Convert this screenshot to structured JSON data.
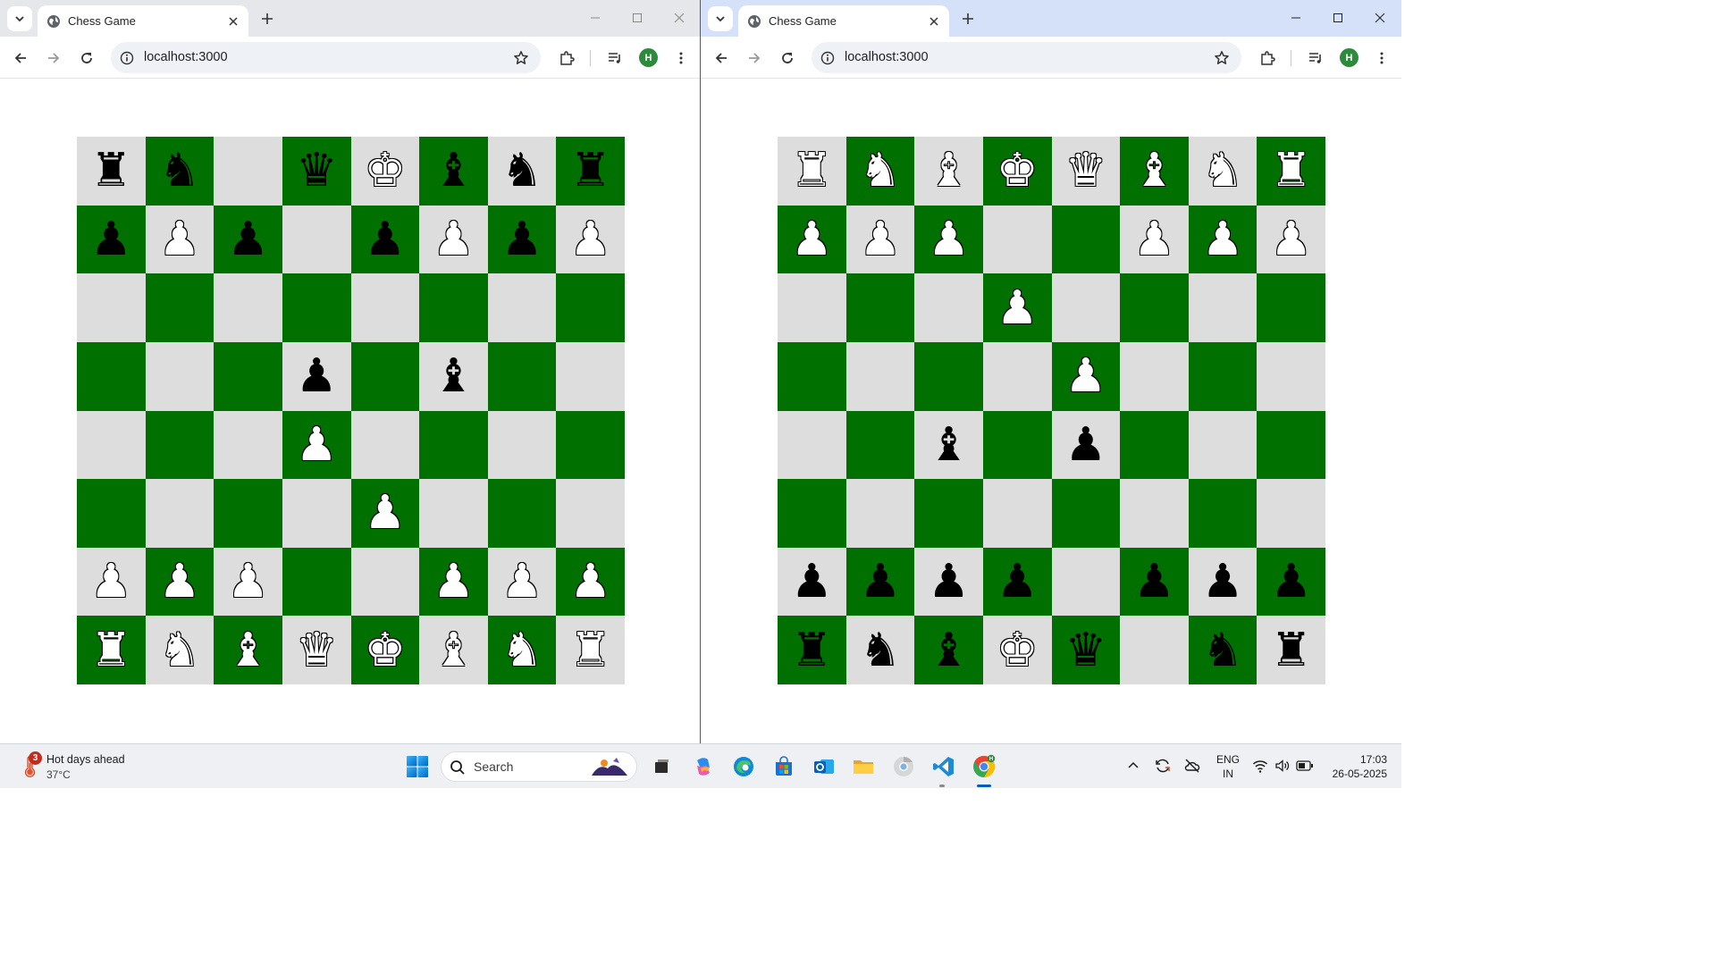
{
  "windows": [
    {
      "id": "left",
      "tab_title": "Chess Game",
      "url": "localhost:3000",
      "profile_initial": "H",
      "board": [
        [
          "bR",
          "bN",
          "",
          "bQ",
          "wK",
          "bB",
          "bN",
          "bR"
        ],
        [
          "bP",
          "wP",
          "bP",
          "",
          "bP",
          "wP",
          "bP",
          "wP"
        ],
        [
          "",
          "",
          "",
          "",
          "",
          "",
          "",
          ""
        ],
        [
          "",
          "",
          "",
          "bP",
          "",
          "bB",
          "",
          ""
        ],
        [
          "",
          "",
          "",
          "wP",
          "",
          "",
          "",
          ""
        ],
        [
          "",
          "",
          "",
          "",
          "wP",
          "",
          "",
          ""
        ],
        [
          "wP",
          "wP",
          "wP",
          "",
          "",
          "wP",
          "wP",
          "wP"
        ],
        [
          "wR",
          "wN",
          "wB",
          "wQ",
          "wK",
          "wB",
          "wN",
          "wR"
        ]
      ]
    },
    {
      "id": "right",
      "tab_title": "Chess Game",
      "url": "localhost:3000",
      "profile_initial": "H",
      "board": [
        [
          "wR",
          "wN",
          "wB",
          "wK",
          "wQ",
          "wB",
          "wN",
          "wR"
        ],
        [
          "wP",
          "wP",
          "wP",
          "",
          "",
          "wP",
          "wP",
          "wP"
        ],
        [
          "",
          "",
          "",
          "wP",
          "",
          "",
          "",
          ""
        ],
        [
          "",
          "",
          "",
          "",
          "wP",
          "",
          "",
          ""
        ],
        [
          "",
          "",
          "bB",
          "",
          "bP",
          "",
          "",
          ""
        ],
        [
          "",
          "",
          "",
          "",
          "",
          "",
          "",
          ""
        ],
        [
          "bP",
          "bP",
          "bP",
          "bP",
          "",
          "bP",
          "bP",
          "bP"
        ],
        [
          "bR",
          "bN",
          "bB",
          "wK",
          "bQ",
          "",
          "bN",
          "bR"
        ]
      ]
    }
  ],
  "board_colors": {
    "light": "#dddddd",
    "dark": "#007000"
  },
  "taskbar": {
    "weather_title": "Hot days ahead",
    "weather_temp": "37°C",
    "weather_badge": "3",
    "search_placeholder": "Search",
    "language": "ENG",
    "region": "IN",
    "time": "17:03",
    "date": "26-05-2025"
  }
}
